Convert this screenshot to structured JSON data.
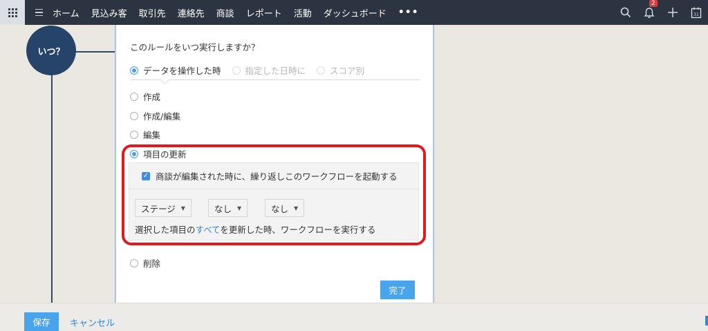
{
  "nav": {
    "items": [
      "ホーム",
      "見込み客",
      "取引先",
      "連絡先",
      "商談",
      "レポート",
      "活動",
      "ダッシュボード"
    ],
    "more": "•••",
    "notification_count": "2",
    "calendar_day": "31"
  },
  "flow": {
    "when_node": "いつ？"
  },
  "panel": {
    "question": "このルールをいつ実行しますか？",
    "tabs": [
      "データを操作した時",
      "指定した日時に",
      "スコア別"
    ],
    "options": [
      "作成",
      "作成/編集",
      "編集",
      "項目の更新",
      "削除"
    ],
    "field_update": {
      "checkbox_label": "商談が編集された時に、繰り返しこのワークフローを起動する",
      "select_1": "ステージ",
      "select_2": "なし",
      "select_3": "なし",
      "desc_prefix": "選択した項目の",
      "desc_link": "すべて",
      "desc_suffix": "を更新した時、ワークフローを実行する"
    },
    "done_label": "完了"
  },
  "footer": {
    "save_label": "保存",
    "cancel_label": "キャンセル"
  },
  "colors": {
    "nav_bg": "#2b3440",
    "accent": "#4aa4ec",
    "highlight": "#e3191f",
    "node": "#26436a"
  }
}
